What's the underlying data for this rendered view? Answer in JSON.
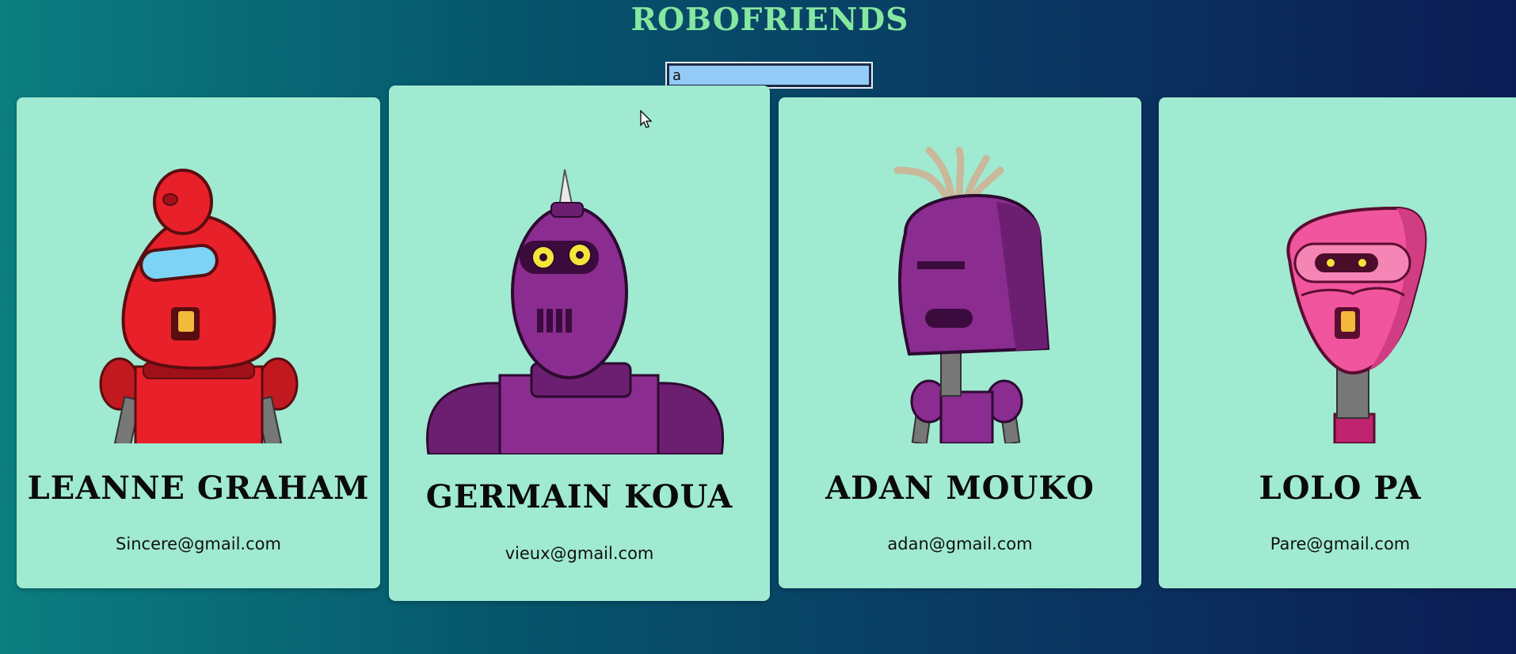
{
  "app": {
    "title": "ROBOFRIENDS"
  },
  "search": {
    "value": "a",
    "selection_color": "#94cbf7"
  },
  "cards": [
    {
      "name": "LEANNE GRAHAM",
      "email": "Sincere@gmail.com",
      "robot_icon": "red-robot-avatar",
      "color": "#e8202a"
    },
    {
      "name": "GERMAIN KOUA",
      "email": "vieux@gmail.com",
      "robot_icon": "purple-robot-avatar",
      "color": "#8a2c90"
    },
    {
      "name": "ADAN MOUKO",
      "email": "adan@gmail.com",
      "robot_icon": "purple-robot-avatar",
      "color": "#8a2c90"
    },
    {
      "name": "LOLO PA",
      "email": "Pare@gmail.com",
      "robot_icon": "pink-robot-avatar",
      "color": "#f0559e"
    }
  ],
  "colors": {
    "title": "#86e8a0",
    "card_background": "#a0ead2",
    "background_start": "#0b7e80",
    "background_end": "#0c1c55"
  }
}
